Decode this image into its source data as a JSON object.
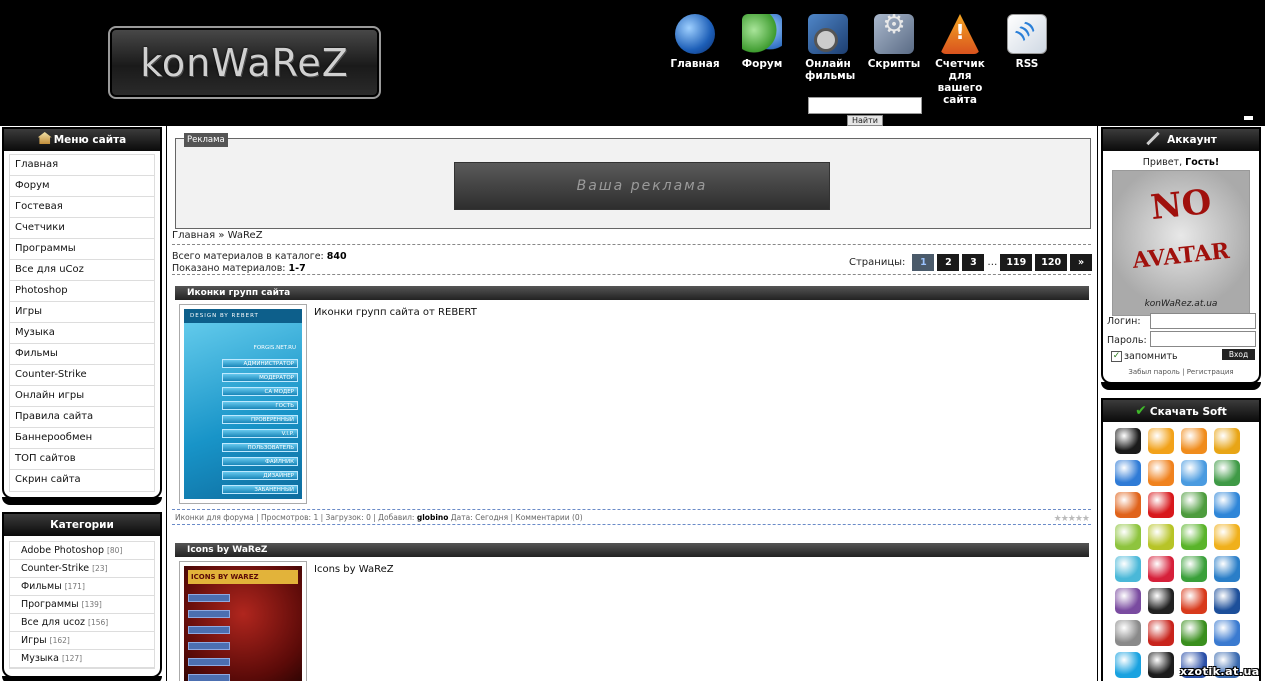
{
  "header": {
    "logo_text": "konWaReZ",
    "nav": [
      {
        "label": "Главная",
        "icon": "globe-icon"
      },
      {
        "label": "Форум",
        "icon": "users-icon"
      },
      {
        "label": "Онлайн фильмы",
        "icon": "film-reel-icon"
      },
      {
        "label": "Скрипты",
        "icon": "scripts-tools-icon"
      },
      {
        "label": "Счетчик для вашего сайта",
        "icon": "warning-counter-icon"
      },
      {
        "label": "RSS",
        "icon": "rss-icon"
      }
    ],
    "search_value": "",
    "search_button": "Найти"
  },
  "menu": {
    "title": "Меню сайта",
    "items": [
      "Главная",
      "Форум",
      "Гостевая",
      "Счетчики",
      "Программы",
      "Все для uCoz",
      "Photoshop",
      "Игры",
      "Музыка",
      "Фильмы",
      "Counter-Strike",
      "Онлайн игры",
      "Правила сайта",
      "Баннерообмен",
      "ТОП сайтов",
      "Скрин сайта"
    ]
  },
  "categories": {
    "title": "Категории",
    "items": [
      {
        "name": "Adobe Photoshop",
        "count": "[80]"
      },
      {
        "name": "Counter-Strike",
        "count": "[23]"
      },
      {
        "name": "Фильмы",
        "count": "[171]"
      },
      {
        "name": "Программы",
        "count": "[139]"
      },
      {
        "name": "Все для ucoz",
        "count": "[156]"
      },
      {
        "name": "Игры",
        "count": "[162]"
      },
      {
        "name": "Музыка",
        "count": "[127]"
      }
    ]
  },
  "ad": {
    "label": "Реклама",
    "banner_text": "Ваша реклама"
  },
  "breadcrumb": "Главная » WaReZ",
  "stats": {
    "total_label": "Всего материалов в каталоге:",
    "total_value": "840",
    "shown_label": "Показано материалов:",
    "shown_value": "1-7"
  },
  "pager": {
    "label": "Страницы:",
    "pages": [
      "1",
      "2",
      "3"
    ],
    "ellipsis": "…",
    "last_pages": [
      "119",
      "120"
    ],
    "next": "»",
    "active": "1"
  },
  "entries": [
    {
      "title": "Иконки групп сайта",
      "description": "Иконки групп сайта от REBERT",
      "thumb_header": "DESIGN BY REBERT",
      "thumb_site": "FORGIS.NET.RU",
      "thumb_rows": [
        "АДМИНИСТРАТОР",
        "МОДЕРАТОР",
        "СА МОДЕР",
        "ГОСТЬ",
        "ПРОВЕРЕННЫЙ",
        "V.I.P.",
        "ПОЛЬЗОВАТЕЛЬ",
        "ФАЙЛНИК",
        "ДИЗАЙНЕР",
        "ЗАБАНЕННЫЙ"
      ],
      "meta": {
        "category": "Иконки для форума",
        "views": "Просмотров: 1",
        "downloads": "Загрузок: 0",
        "added_label": "Добавил:",
        "author": "globino",
        "date": "Дата: Сегодня",
        "comments": "Комментарии (0)"
      }
    },
    {
      "title": "Icons by WaReZ",
      "description": "Icons by WaReZ",
      "thumb_header": "ICONS BY WAREZ"
    }
  ],
  "account": {
    "title": "Аккаунт",
    "greeting": "Привет,",
    "user": "Гость!",
    "avatar_no": "NO",
    "avatar_text": "AVATAR",
    "avatar_site": "konWaRez.at.ua",
    "login_label": "Логин:",
    "password_label": "Пароль:",
    "remember": "запомнить",
    "login_button": "Вход",
    "forgot": "Забыл пароль",
    "separator": "|",
    "register": "Регистрация"
  },
  "soft": {
    "title": "Скачать Soft",
    "apps": [
      {
        "name": "kmplayer-icon",
        "color": "#1b1b1b"
      },
      {
        "name": "daemon-tools-icon",
        "color": "#f2a21a"
      },
      {
        "name": "gom-player-icon",
        "color": "#f08c1c"
      },
      {
        "name": "aimp-icon",
        "color": "#e8a516"
      },
      {
        "name": "media-player-icon",
        "color": "#2f7bd6"
      },
      {
        "name": "vlc-icon",
        "color": "#f0821e"
      },
      {
        "name": "obs-icon",
        "color": "#4a9be0"
      },
      {
        "name": "google-drive-icon",
        "color": "#3f9a46"
      },
      {
        "name": "firefox-icon",
        "color": "#e0631b"
      },
      {
        "name": "opera-icon",
        "color": "#d8181c"
      },
      {
        "name": "chrome-icon",
        "color": "#4d9c3d"
      },
      {
        "name": "internet-explorer-icon",
        "color": "#2f86d8"
      },
      {
        "name": "android-icon",
        "color": "#8ec43e"
      },
      {
        "name": "icq-flower-icon",
        "color": "#b7c427"
      },
      {
        "name": "icq-icon",
        "color": "#5ab42a"
      },
      {
        "name": "mail-agent-icon",
        "color": "#f0b01b"
      },
      {
        "name": "cd-burner-icon",
        "color": "#4ab8d8"
      },
      {
        "name": "kaspersky-icon",
        "color": "#d6203a"
      },
      {
        "name": "dr-web-icon",
        "color": "#3aa03a"
      },
      {
        "name": "avast-icon",
        "color": "#2a7ec8"
      },
      {
        "name": "winrar-icon",
        "color": "#7a4ba0"
      },
      {
        "name": "7zip-icon",
        "color": "#222222"
      },
      {
        "name": "ccleaner-icon",
        "color": "#d83a1c"
      },
      {
        "name": "media-classic-icon",
        "color": "#1d4f9a"
      },
      {
        "name": "printer-icon",
        "color": "#8a8a8a"
      },
      {
        "name": "filezilla-icon",
        "color": "#c8241c"
      },
      {
        "name": "utorrent-icon",
        "color": "#3a8f1e"
      },
      {
        "name": "download-arrow-icon",
        "color": "#3a7ad0"
      },
      {
        "name": "skype-icon",
        "color": "#19a2e0"
      },
      {
        "name": "bat-icon",
        "color": "#1c1c1c"
      },
      {
        "name": "save-disk-icon",
        "color": "#2a4fa8"
      },
      {
        "name": "app-box-icon",
        "color": "#3a6ab0"
      }
    ]
  },
  "watermark": "xzotik.at.ua"
}
